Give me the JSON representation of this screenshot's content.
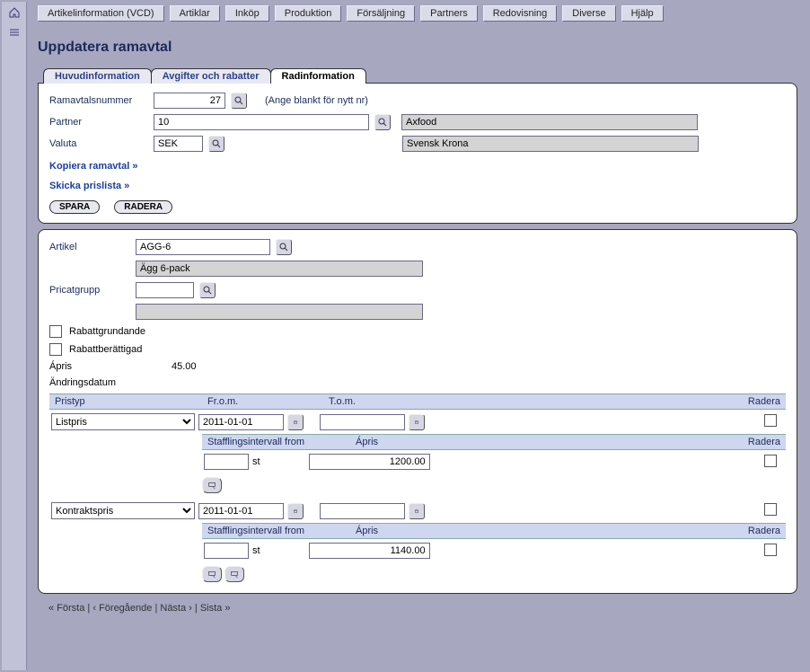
{
  "nav": [
    "Artikelinformation (VCD)",
    "Artiklar",
    "Inköp",
    "Produktion",
    "Försäljning",
    "Partners",
    "Redovisning",
    "Diverse",
    "Hjälp"
  ],
  "title": "Uppdatera ramavtal",
  "tabs": [
    "Huvudinformation",
    "Avgifter och rabatter",
    "Radinformation"
  ],
  "activeTab": 2,
  "form": {
    "ramavtalsnummer_label": "Ramavtalsnummer",
    "ramavtalsnummer_value": "27",
    "ramavtals_hint": "(Ange blankt för nytt nr)",
    "partner_label": "Partner",
    "partner_value": "10",
    "partner_name": "Axfood",
    "valuta_label": "Valuta",
    "valuta_value": "SEK",
    "valuta_name": "Svensk Krona"
  },
  "links": {
    "copy": "Kopiera ramavtal »",
    "send": "Skicka prislista »"
  },
  "buttons": {
    "save": "SPARA",
    "delete": "RADERA"
  },
  "article": {
    "label": "Artikel",
    "value": "AGG-6",
    "name": "Ägg 6-pack",
    "pricat_label": "Pricatgrupp",
    "pricat_value": "",
    "pricat_name": "",
    "rabattgrundande_label": "Rabattgrundande",
    "rabattberattigad_label": "Rabattberättigad",
    "apris_label": "Ápris",
    "apris_value": "45.00",
    "andring_label": "Ändringsdatum",
    "andring_value": ""
  },
  "priceHeaders": {
    "pristyp": "Pristyp",
    "from": "Fr.o.m.",
    "tom": "T.o.m.",
    "radera": "Radera"
  },
  "stafflingHeaders": {
    "interval": "Stafflingsintervall from",
    "apris": "Ápris",
    "radera": "Radera"
  },
  "unit": "st",
  "priceRows": [
    {
      "type": "Listpris",
      "from": "2011-01-01",
      "tom": "",
      "interval": "",
      "apris": "1200.00"
    },
    {
      "type": "Kontraktspris",
      "from": "2011-01-01",
      "tom": "",
      "interval": "",
      "apris": "1140.00"
    }
  ],
  "pager": {
    "first": "« Första",
    "prev": "‹ Föregående",
    "next": "Nästa ›",
    "last": "Sista »",
    "sep": " | "
  }
}
